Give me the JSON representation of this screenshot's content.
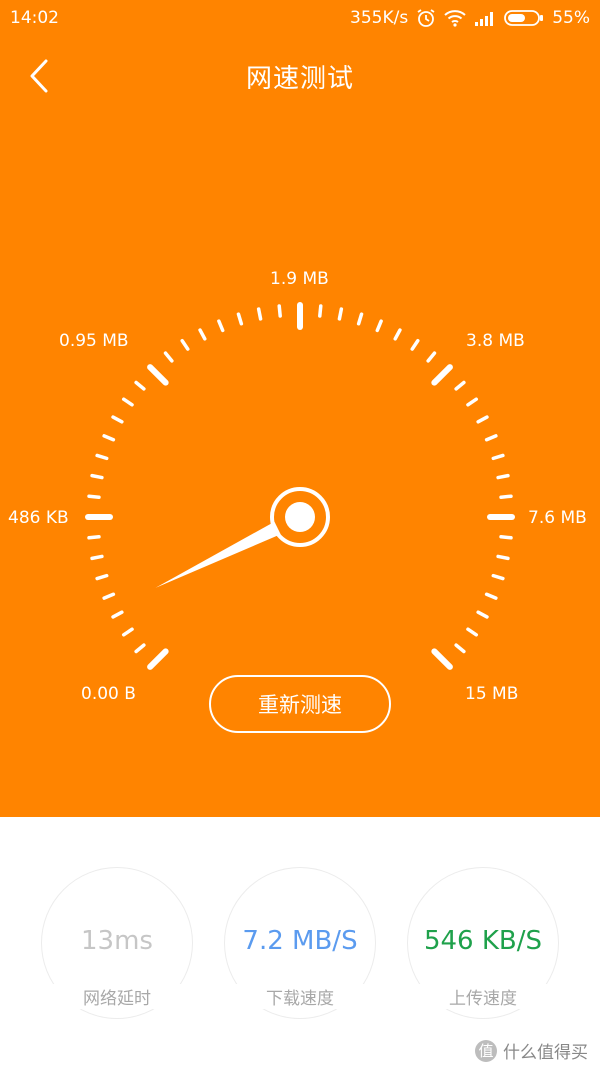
{
  "status_bar": {
    "time": "14:02",
    "net_speed": "355K/s",
    "battery": "55%",
    "icons": [
      "alarm-icon",
      "wifi-icon",
      "signal-icon",
      "battery-icon"
    ]
  },
  "header": {
    "title": "网速测试",
    "back_icon": "chevron-left-icon"
  },
  "gauge": {
    "scale_labels": [
      "0.00 B",
      "486 KB",
      "0.95 MB",
      "1.9 MB",
      "3.8 MB",
      "7.6 MB",
      "15 MB"
    ],
    "needle_position": 0.07
  },
  "retest_button": "重新测速",
  "stats": [
    {
      "value": "13ms",
      "label": "网络延时",
      "color": "#c6c6c6"
    },
    {
      "value": "7.2 MB/S",
      "label": "下载速度",
      "color": "#5b9bef"
    },
    {
      "value": "546 KB/S",
      "label": "上传速度",
      "color": "#1fa14b"
    }
  ],
  "watermark": {
    "badge": "值",
    "text": "什么值得买"
  },
  "colors": {
    "accent": "#ff8400",
    "download": "#5b9bef",
    "upload": "#1fa14b",
    "latency": "#c6c6c6"
  }
}
